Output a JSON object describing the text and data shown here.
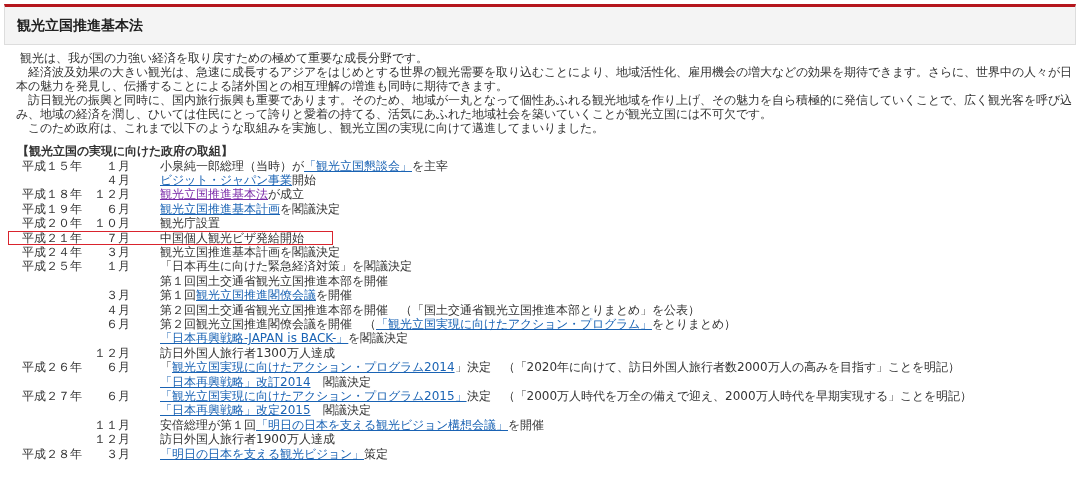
{
  "header": {
    "title": "観光立国推進基本法"
  },
  "paragraphs": [
    "観光は、我が国の力強い経済を取り戻すための極めて重要な成長分野です。",
    "経済波及効果の大きい観光は、急速に成長するアジアをはじめとする世界の観光需要を取り込むことにより、地域活性化、雇用機会の増大などの効果を期待できます。さらに、世界中の人々が日本の魅力を発見し、伝播することによる諸外国との相互理解の増進も同時に期待できます。",
    "訪日観光の振興と同時に、国内旅行振興も重要であります。そのため、地域が一丸となって個性あふれる観光地域を作り上げ、その魅力を自ら積極的に発信していくことで、広く観光客を呼び込み、地域の経済を潤し、ひいては住民にとって誇りと愛着の持てる、活気にあふれた地域社会を築いていくことが観光立国には不可欠です。",
    "このため政府は、これまで以下のような取組みを実施し、観光立国の実現に向けて邁進してまいりました。"
  ],
  "timeline": {
    "heading": "【観光立国の実現に向けた政府の取組】",
    "rows": [
      {
        "year": "平成１５年",
        "month": "１月",
        "highlighted": false,
        "segments": [
          {
            "kind": "text",
            "text": "小泉純一郎総理（当時）が"
          },
          {
            "kind": "link",
            "text": "「観光立国懇談会」"
          },
          {
            "kind": "text",
            "text": "を主宰"
          }
        ]
      },
      {
        "month": "４月",
        "highlighted": false,
        "segments": [
          {
            "kind": "link",
            "text": "ビジット・ジャパン事業"
          },
          {
            "kind": "text",
            "text": "開始"
          }
        ]
      },
      {
        "year": "平成１８年",
        "month": "１２月",
        "highlighted": false,
        "segments": [
          {
            "kind": "visited-link",
            "text": "観光立国推進基本法"
          },
          {
            "kind": "text",
            "text": "が成立"
          }
        ]
      },
      {
        "year": "平成１９年",
        "month": "６月",
        "highlighted": false,
        "segments": [
          {
            "kind": "link",
            "text": "観光立国推進基本計画"
          },
          {
            "kind": "text",
            "text": "を閣議決定"
          }
        ]
      },
      {
        "year": "平成２０年",
        "month": "１０月",
        "highlighted": false,
        "segments": [
          {
            "kind": "text",
            "text": "観光庁設置"
          }
        ]
      },
      {
        "year": "平成２１年",
        "month": "７月",
        "highlighted": true,
        "segments": [
          {
            "kind": "text",
            "text": "中国個人観光ビザ発給開始"
          }
        ]
      },
      {
        "year": "平成２４年",
        "month": "３月",
        "highlighted": false,
        "segments": [
          {
            "kind": "text",
            "text": "観光立国推進基本計画を閣議決定"
          }
        ]
      },
      {
        "year": "平成２５年",
        "month": "１月",
        "highlighted": false,
        "segments": [
          {
            "kind": "text",
            "text": "「日本再生に向けた緊急経済対策」を閣議決定"
          }
        ]
      },
      {
        "highlighted": false,
        "segments": [
          {
            "kind": "text",
            "text": "第１回国土交通省観光立国推進本部を開催"
          }
        ]
      },
      {
        "month": "３月",
        "highlighted": false,
        "segments": [
          {
            "kind": "text",
            "text": "第１回"
          },
          {
            "kind": "link",
            "text": "観光立国推進閣僚会議"
          },
          {
            "kind": "text",
            "text": "を開催"
          }
        ]
      },
      {
        "month": "４月",
        "highlighted": false,
        "segments": [
          {
            "kind": "text",
            "text": "第２回国土交通省観光立国推進本部を開催　（「国土交通省観光立国推進本部とりまとめ」を公表）"
          }
        ]
      },
      {
        "month": "６月",
        "highlighted": false,
        "segments": [
          {
            "kind": "text",
            "text": "第２回観光立国推進閣僚会議を開催　（"
          },
          {
            "kind": "link",
            "text": "「観光立国実現に向けたアクション・プログラム」"
          },
          {
            "kind": "text",
            "text": "をとりまとめ）"
          }
        ]
      },
      {
        "highlighted": false,
        "segments": [
          {
            "kind": "link",
            "text": "「日本再興戦略-JAPAN is BACK-」"
          },
          {
            "kind": "text",
            "text": "を閣議決定"
          }
        ]
      },
      {
        "month": "１２月",
        "highlighted": false,
        "segments": [
          {
            "kind": "text",
            "text": "訪日外国人旅行者1300万人達成"
          }
        ]
      },
      {
        "year": "平成２６年",
        "month": "６月",
        "highlighted": false,
        "segments": [
          {
            "kind": "text",
            "text": "「"
          },
          {
            "kind": "link",
            "text": "観光立国実現に向けたアクション・プログラム2014"
          },
          {
            "kind": "text",
            "text": "」決定　（「2020年に向けて、訪日外国人旅行者数2000万人の高みを目指す」ことを明記）"
          }
        ]
      },
      {
        "highlighted": false,
        "segments": [
          {
            "kind": "link",
            "text": "「日本再興戦略」改訂2014"
          },
          {
            "kind": "text",
            "text": "　閣議決定"
          }
        ]
      },
      {
        "year": "平成２７年",
        "month": "６月",
        "highlighted": false,
        "segments": [
          {
            "kind": "link",
            "text": "「観光立国実現に向けたアクション・プログラム2015」"
          },
          {
            "kind": "text",
            "text": "決定　（「2000万人時代を万全の備えで迎え、2000万人時代を早期実現する」ことを明記）"
          }
        ]
      },
      {
        "highlighted": false,
        "segments": [
          {
            "kind": "link",
            "text": "「日本再興戦略」改定2015"
          },
          {
            "kind": "text",
            "text": "　閣議決定"
          }
        ]
      },
      {
        "month": "１１月",
        "highlighted": false,
        "segments": [
          {
            "kind": "text",
            "text": "安倍総理が第１回"
          },
          {
            "kind": "link",
            "text": "「明日の日本を支える観光ビジョン構想会議」"
          },
          {
            "kind": "text",
            "text": "を開催"
          }
        ]
      },
      {
        "month": "１２月",
        "highlighted": false,
        "segments": [
          {
            "kind": "text",
            "text": "訪日外国人旅行者1900万人達成"
          }
        ]
      },
      {
        "year": "平成２８年",
        "month": "３月",
        "highlighted": false,
        "segments": [
          {
            "kind": "link",
            "text": "「明日の日本を支える観光ビジョン」"
          },
          {
            "kind": "text",
            "text": "策定"
          }
        ]
      }
    ]
  }
}
